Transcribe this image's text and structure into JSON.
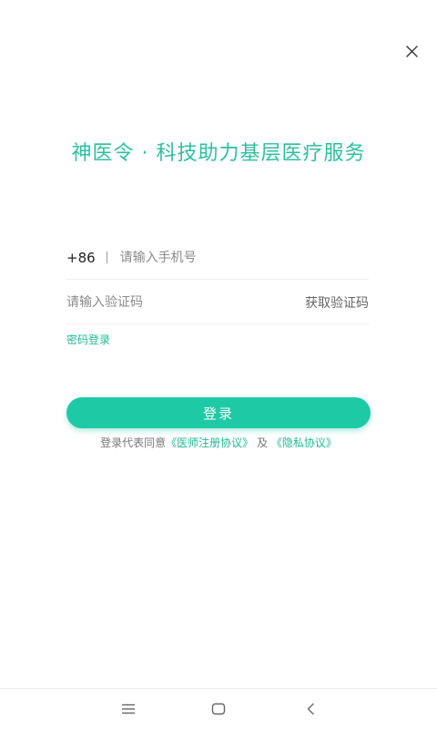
{
  "header": {
    "close_icon": "close-icon",
    "slogan": "神医令 · 科技助力基层医疗服务"
  },
  "form": {
    "country_code": "+86",
    "phone_placeholder": "请输入手机号",
    "phone_value": "",
    "code_placeholder": "请输入验证码",
    "code_value": "",
    "get_code_label": "获取验证码",
    "password_login_label": "密码登录",
    "login_label": "登录"
  },
  "agreement": {
    "prefix": "登录代表同意",
    "doctor_agreement": "《医师注册协议》",
    "conjunction": "及",
    "privacy_agreement": "《隐私协议》"
  },
  "colors": {
    "accent": "#1ec9a6",
    "slogan": "#2ebfa0",
    "link": "#1fb994"
  },
  "navbar": {
    "icons": [
      "menu-icon",
      "home-square-icon",
      "back-chevron-icon"
    ]
  }
}
